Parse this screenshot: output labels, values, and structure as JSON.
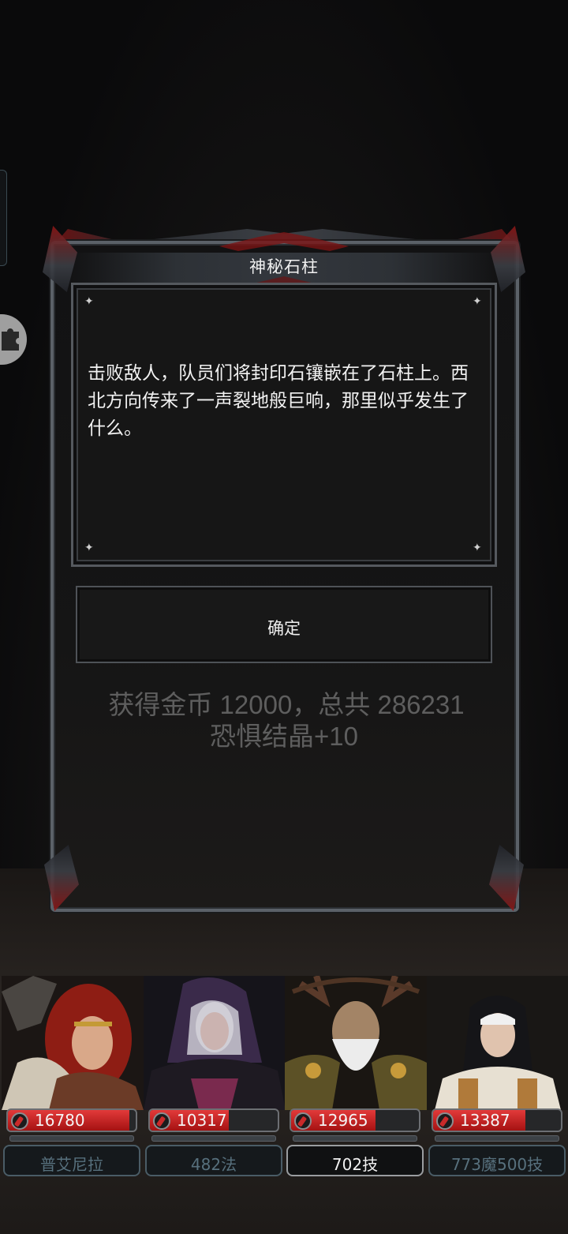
{
  "dialog": {
    "title": "神秘石柱",
    "message": "击败敌人，队员们将封印石镶嵌在了石柱上。西北方向传来了一声裂地般巨响，那里似乎发生了什么。",
    "confirm_label": "确定"
  },
  "reward": {
    "line1": "获得金币 12000，总共 286231",
    "line2": "恐惧结晶+10"
  },
  "party": [
    {
      "hp": "16780",
      "hp_fraction": 0.95,
      "label": "普艾尼拉",
      "selected": false
    },
    {
      "hp": "10317",
      "hp_fraction": 0.62,
      "label": "482法",
      "selected": false
    },
    {
      "hp": "12965",
      "hp_fraction": 0.66,
      "label": "702技",
      "selected": true
    },
    {
      "hp": "13387",
      "hp_fraction": 0.72,
      "label": "773魔500技",
      "selected": false
    }
  ],
  "colors": {
    "hp_red": "#c41e1e",
    "frame_accent": "#8a1515",
    "reward_text": "#5e5e5e"
  },
  "icons": [
    "puzzle-icon",
    "sparkle-icon",
    "blood-drop-icon"
  ]
}
